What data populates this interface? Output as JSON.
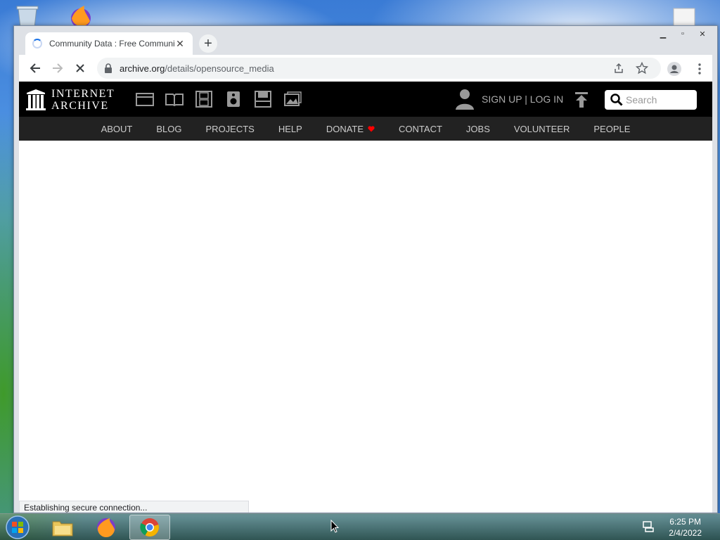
{
  "browser": {
    "tab_title": "Community Data : Free Community",
    "url_host": "archive.org",
    "url_path": "/details/opensource_media",
    "status_text": "Establishing secure connection..."
  },
  "site": {
    "logo_line1": "INTERNET",
    "logo_line2": "ARCHIVE",
    "media_icons": [
      "web-icon",
      "texts-icon",
      "video-icon",
      "audio-icon",
      "software-icon",
      "images-icon"
    ],
    "signin_label": "SIGN UP | LOG IN",
    "search_placeholder": "Search",
    "nav": {
      "about": "ABOUT",
      "blog": "BLOG",
      "projects": "PROJECTS",
      "help": "HELP",
      "donate": "DONATE",
      "contact": "CONTACT",
      "jobs": "JOBS",
      "volunteer": "VOLUNTEER",
      "people": "PEOPLE"
    }
  },
  "taskbar": {
    "time": "6:25 PM",
    "date": "2/4/2022"
  },
  "colors": {
    "donate_heart": "#ff0000",
    "ia_header": "#000000",
    "ia_nav": "#222222"
  }
}
